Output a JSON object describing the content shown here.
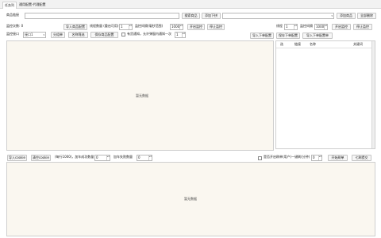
{
  "tabs": [
    {
      "label": "任务列"
    },
    {
      "label": "通用配置-代理配置"
    }
  ],
  "row1": {
    "keyword_label": "商品链接",
    "search_button": "搜索商品",
    "add_search_button": "添加下拼",
    "add_product_button": "添加商品",
    "delete_all_button": "全部删除"
  },
  "row2": {
    "monitor_count_label": "监控次数: 0",
    "import_button": "导入商品配置",
    "threads_label": "线程数量 (重启可用)",
    "threads_value": "1",
    "interval_label": "监控间隔(毫秒范围)",
    "interval_value": "1000",
    "start_button": "开启监控",
    "stop_button": "停止监控",
    "threads2_label": "线程",
    "threads2_value": "1",
    "interval2_label": "监控间隔",
    "interval2_value": "1000",
    "start2_button": "开启监控",
    "stop2_button": "停止监控"
  },
  "row3": {
    "port_label": "监控接口",
    "port_value": "接口1",
    "btn_a": "分组单",
    "btn_b": "名称筛选",
    "btn_c": "保存商品配置",
    "checkbox_label": "有货通知，允许弹窗内通知一次",
    "notify_value": "1",
    "import_order_button": "导入下单配置",
    "save_order_button": "保存下单配置",
    "import_order2_button": "导入下单配置单"
  },
  "main_panel": {
    "empty_text": "暂无数据"
  },
  "order_grid": {
    "headers": [
      "选",
      "链接",
      "名称",
      "",
      "关键词"
    ]
  },
  "bottom_bar": {
    "import_button": "导入cookie",
    "clear_button": "清空cookie",
    "tip_label": "(每行1000)，加车成功数量",
    "success_value": "0",
    "cart_count_label": "加车失败数量",
    "cart_value": "0",
    "checkbox_label": "是否开启刷单(用户)一键刷(分钟)",
    "minutes_value": "0",
    "start_button": "开始刷单",
    "stop_button": "七刷提交"
  },
  "log_panel": {
    "empty_text": "暂无数据"
  }
}
